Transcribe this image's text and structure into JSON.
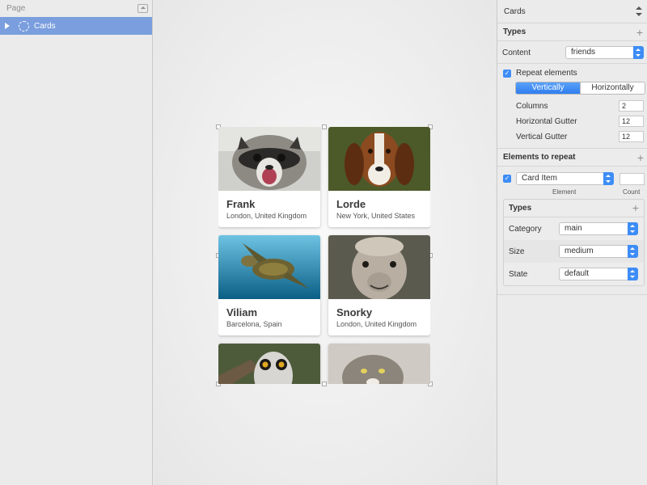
{
  "left_panel": {
    "header": "Page",
    "layers": [
      {
        "label": "Cards"
      }
    ]
  },
  "cards": [
    {
      "name": "Frank",
      "location": "London, United Kingdom",
      "photo": "raccoon"
    },
    {
      "name": "Lorde",
      "location": "New York, United States",
      "photo": "beagle"
    },
    {
      "name": "Viliam",
      "location": "Barcelona, Spain",
      "photo": "sea-turtle"
    },
    {
      "name": "Snorky",
      "location": "London, United Kingdom",
      "photo": "llama"
    },
    {
      "name": "",
      "location": "",
      "photo": "lemur"
    },
    {
      "name": "",
      "location": "",
      "photo": "manul-cat"
    }
  ],
  "inspector": {
    "title": "Cards",
    "types_label": "Types",
    "content_label": "Content",
    "content_value": "friends",
    "repeat_label": "Repeat elements",
    "repeat_checked": true,
    "direction_options": [
      "Vertically",
      "Horizontally"
    ],
    "direction_selected": "Vertically",
    "columns_label": "Columns",
    "columns_value": "2",
    "hgutter_label": "Horizontal Gutter",
    "hgutter_value": "12",
    "vgutter_label": "Vertical Gutter",
    "vgutter_value": "12",
    "elements_label": "Elements to repeat",
    "element_value": "Card Item",
    "element_col": "Element",
    "count_col": "Count",
    "count_value": "",
    "nested": {
      "types_label": "Types",
      "category_label": "Category",
      "category_value": "main",
      "size_label": "Size",
      "size_value": "medium",
      "state_label": "State",
      "state_value": "default"
    }
  },
  "colors": {
    "accent": "#3e8df7",
    "selection": "#7a9ede"
  }
}
